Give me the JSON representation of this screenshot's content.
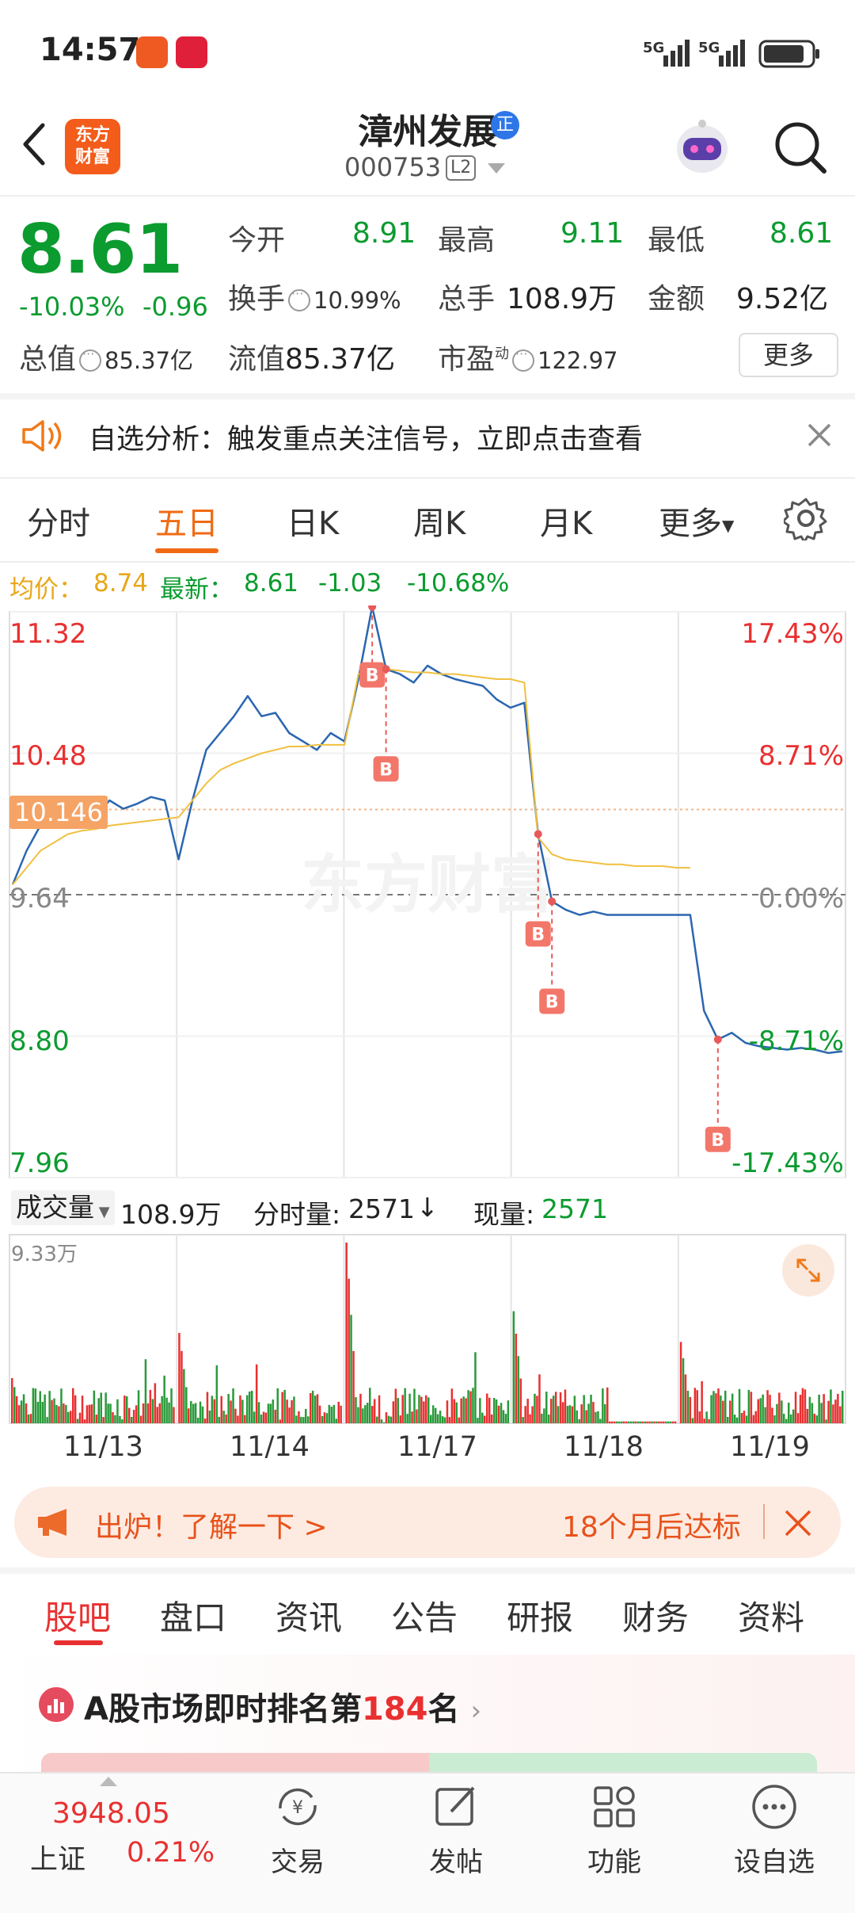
{
  "status_bar": {
    "time": "14:57",
    "network": "5G"
  },
  "header": {
    "logo_line1": "东方",
    "logo_line2": "财富",
    "stock_name": "漳州发展",
    "name_badge": "正",
    "stock_code": "000753",
    "level_badge": "L2"
  },
  "quote": {
    "price": "8.61",
    "change_pct": "-10.03%",
    "change_abs": "-0.96",
    "open_label": "今开",
    "open": "8.91",
    "high_label": "最高",
    "high": "9.11",
    "low_label": "最低",
    "low": "8.61",
    "turnover_label": "换手",
    "turnover": "10.99%",
    "volume_label": "总手",
    "volume": "108.9万",
    "amount_label": "金额",
    "amount": "9.52亿",
    "total_value_label": "总值",
    "total_value": "85.37亿",
    "float_value_label": "流值",
    "float_value": "85.37亿",
    "pe_label": "市盈",
    "pe_superscript": "动",
    "pe": "122.97",
    "more_button": "更多"
  },
  "banner": {
    "text": "自选分析：触发重点关注信号，立即点击查看"
  },
  "chart_tabs": {
    "items": [
      "分时",
      "五日",
      "日K",
      "周K",
      "月K",
      "更多"
    ],
    "active": "五日"
  },
  "chart_header": {
    "avg_label": "均价：",
    "avg_value": "8.74",
    "latest_label": "最新：",
    "latest_value": "8.61",
    "latest_change": "-1.03",
    "latest_pct": "-10.68%"
  },
  "chart_data": {
    "type": "line",
    "title": "",
    "y_left_ticks": [
      "11.32",
      "10.48",
      "9.64",
      "8.80",
      "7.96"
    ],
    "y_right_ticks": [
      "17.43%",
      "8.71%",
      "0.00%",
      "-8.71%",
      "-17.43%"
    ],
    "ylim": [
      7.96,
      11.32
    ],
    "reference_price": 9.64,
    "cursor_price": "10.146",
    "x_categories": [
      "11/13",
      "11/14",
      "11/17",
      "11/18",
      "11/19"
    ],
    "series": [
      {
        "name": "价格",
        "color": "#2b66b0",
        "values": [
          9.7,
          9.9,
          10.05,
          10.15,
          10.2,
          10.12,
          10.1,
          10.2,
          10.15,
          10.18,
          10.22,
          10.2,
          9.85,
          10.2,
          10.5,
          10.6,
          10.7,
          10.82,
          10.7,
          10.72,
          10.6,
          10.55,
          10.5,
          10.6,
          10.55,
          10.92,
          11.35,
          10.98,
          10.95,
          10.9,
          11.0,
          10.95,
          10.92,
          10.9,
          10.88,
          10.8,
          10.75,
          10.78,
          10.0,
          9.6,
          9.55,
          9.52,
          9.54,
          9.52,
          9.52,
          9.52,
          9.52,
          9.52,
          9.52,
          9.52,
          8.95,
          8.78,
          8.82,
          8.76,
          8.74,
          8.73,
          8.72,
          8.73,
          8.72,
          8.7,
          8.71
        ]
      },
      {
        "name": "均价",
        "color": "#f0c040",
        "values": [
          9.7,
          9.8,
          9.9,
          9.95,
          10.0,
          10.02,
          10.03,
          10.05,
          10.06,
          10.07,
          10.08,
          10.09,
          10.1,
          10.2,
          10.3,
          10.38,
          10.42,
          10.45,
          10.48,
          10.5,
          10.52,
          10.52,
          10.53,
          10.53,
          10.53,
          10.95,
          10.98,
          10.98,
          10.97,
          10.96,
          10.96,
          10.95,
          10.95,
          10.94,
          10.93,
          10.92,
          10.92,
          10.9,
          9.98,
          9.88,
          9.85,
          9.84,
          9.83,
          9.82,
          9.82,
          9.81,
          9.81,
          9.81,
          9.8,
          9.8,
          null,
          null,
          null,
          null,
          null,
          null,
          null,
          null,
          null,
          null,
          null
        ]
      }
    ],
    "markers": [
      "B",
      "B",
      "B",
      "B",
      "B"
    ],
    "volume": {
      "label": "成交量",
      "total": "108.9万",
      "tick_volume_label": "分时量:",
      "tick_volume": "2571",
      "now_volume_label": "现量:",
      "now_volume": "2571",
      "max_label": "9.33万"
    }
  },
  "promo": {
    "text_left": "出炉！了解一下 >",
    "text_right": "18个月后达标"
  },
  "bottom_tabs": {
    "items": [
      "股吧",
      "盘口",
      "资讯",
      "公告",
      "研报",
      "财务",
      "资料"
    ],
    "active": "股吧"
  },
  "rank": {
    "text_prefix": "A股市场即时排名第",
    "rank_number": "184",
    "text_suffix": "名"
  },
  "bottom_nav": {
    "index_value": "3948.05",
    "index_name": "上证",
    "index_pct": "0.21%",
    "items": [
      "交易",
      "发帖",
      "功能",
      "设自选"
    ]
  },
  "colors": {
    "up": "#e93030",
    "down": "#0b9b2f",
    "accent": "#f06a14",
    "price_line": "#2b66b0",
    "avg_line": "#f0c040"
  }
}
